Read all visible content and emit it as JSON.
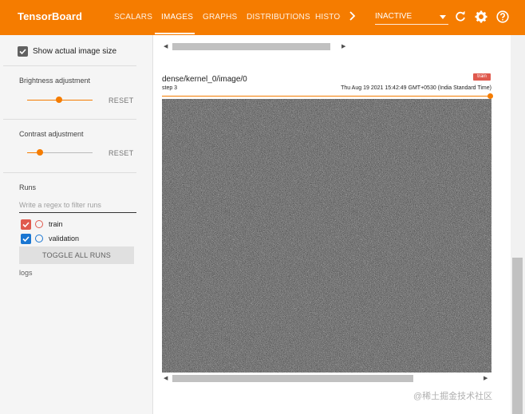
{
  "header": {
    "brand": "TensorBoard",
    "tabs": [
      {
        "label": "SCALARS"
      },
      {
        "label": "IMAGES"
      },
      {
        "label": "GRAPHS"
      },
      {
        "label": "DISTRIBUTIONS"
      },
      {
        "label": "HISTOGRAMS"
      }
    ],
    "active_tab": "IMAGES",
    "run_select_value": "INACTIVE",
    "accent_color": "#f57c00"
  },
  "sidebar": {
    "show_actual_size_label": "Show actual image size",
    "show_actual_size_checked": true,
    "brightness": {
      "title": "Brightness adjustment",
      "reset_label": "RESET",
      "value": 0.5
    },
    "contrast": {
      "title": "Contrast adjustment",
      "reset_label": "RESET",
      "value": 0.2
    },
    "runs": {
      "title": "Runs",
      "filter_placeholder": "Write a regex to filter runs",
      "items": [
        {
          "label": "train",
          "checked": true,
          "color": "#e05a4e"
        },
        {
          "label": "validation",
          "checked": true,
          "color": "#1976d2"
        }
      ],
      "toggle_label": "TOGGLE ALL RUNS",
      "logdir": "logs"
    }
  },
  "card": {
    "tag": "dense/kernel_0/image/0",
    "step": "step 3",
    "timestamp": "Thu Aug 19 2021 15:42:49 GMT+0530 (India Standard Time)",
    "run": "train",
    "run_color": "#e05a4e"
  },
  "watermark": "@稀土掘金技术社区"
}
